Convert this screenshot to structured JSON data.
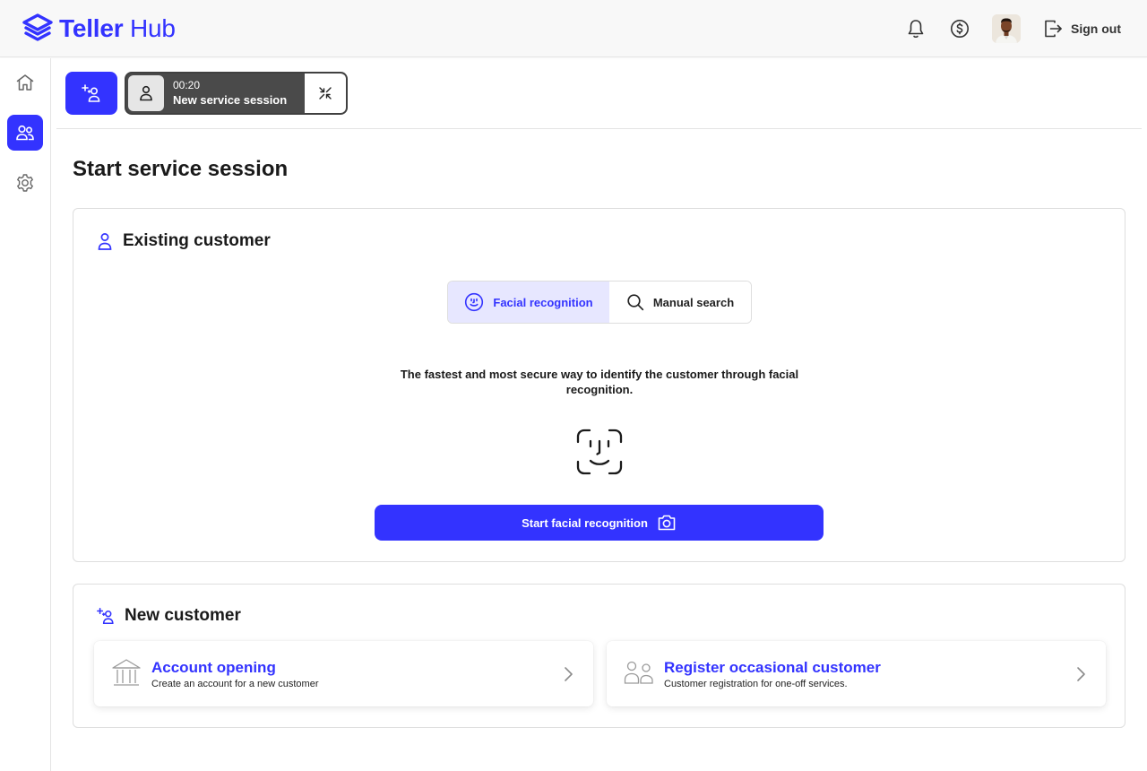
{
  "app": {
    "brand_bold": "Teller",
    "brand_light": " Hub",
    "accent_color": "#3333ff"
  },
  "header": {
    "icons": [
      "bell-icon",
      "dollar-circle-icon"
    ],
    "sign_out_label": "Sign out"
  },
  "sidebar": {
    "items": [
      {
        "icon": "home-icon",
        "active": false
      },
      {
        "icon": "users-icon",
        "active": true
      },
      {
        "icon": "gear-icon",
        "active": false
      }
    ]
  },
  "session": {
    "time": "00:20",
    "title": "New service session"
  },
  "main": {
    "page_title": "Start service session",
    "existing": {
      "heading": "Existing customer",
      "tabs": [
        {
          "label": "Facial recognition",
          "icon": "face-smile-icon",
          "active": true
        },
        {
          "label": "Manual search",
          "icon": "search-icon",
          "active": false
        }
      ],
      "description": "The fastest and most secure way to identify the customer through facial recognition.",
      "start_button_label": "Start facial recognition"
    },
    "new_customer": {
      "heading": "New customer",
      "options": [
        {
          "title": "Account opening",
          "subtitle": "Create an account for a new customer",
          "icon": "bank-icon"
        },
        {
          "title": "Register occasional customer",
          "subtitle": "Customer registration for one-off services.",
          "icon": "users-outline-icon"
        }
      ]
    }
  }
}
